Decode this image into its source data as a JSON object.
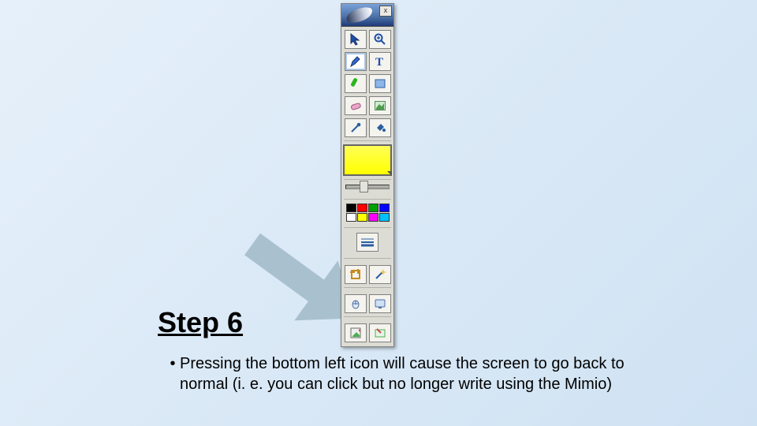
{
  "slide": {
    "heading": "Step 6",
    "bullet": "Pressing the bottom left icon will cause the screen to go back to normal (i. e. you can click but no longer write using the Mimio)"
  },
  "palette": {
    "header_icon": "brush-icon",
    "close_label": "x",
    "tools_row1": [
      "arrow-pointer",
      "zoom-in"
    ],
    "tools_row2": [
      "pencil",
      "text-tool"
    ],
    "tools_row3": [
      "highlighter-green",
      "rectangle"
    ],
    "tools_row4": [
      "eraser",
      "image-insert"
    ],
    "tools_row5": [
      "eyedropper",
      "fill-bucket"
    ],
    "selected_color": "#ffff00",
    "mini_colors": [
      "#000000",
      "#ff0000",
      "#00a000",
      "#0000ff",
      "#ffffff",
      "#ffff00",
      "#ff00ff",
      "#00c0ff"
    ],
    "lines_icon": "line-style",
    "tools_row6": [
      "crop-tool",
      "wand-tool"
    ],
    "tools_row7": [
      "mouse-mode",
      "screen-mode"
    ],
    "tools_row8": [
      "exit-to-normal",
      "annotate-screen"
    ]
  }
}
